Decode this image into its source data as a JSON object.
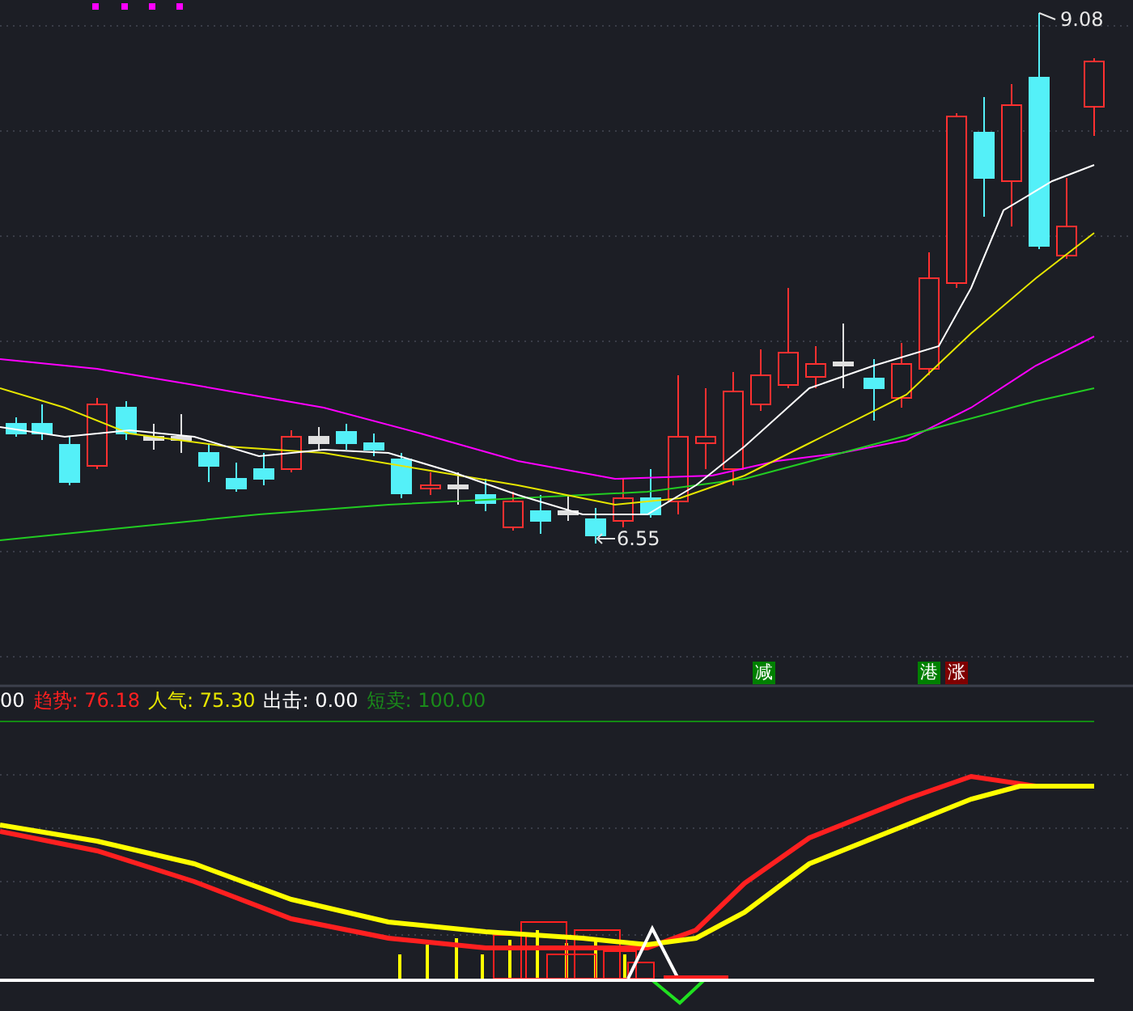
{
  "price_panel": {
    "high_label": "9.08",
    "low_label": "6.55"
  },
  "signals": [
    {
      "text": "减",
      "color": "#008000"
    },
    {
      "text": "港",
      "color": "#008000"
    },
    {
      "text": "涨",
      "color": "#800000"
    }
  ],
  "indicator_legend": [
    {
      "label": "00",
      "color": "#ffffff"
    },
    {
      "label": "趋势: 76.18",
      "color": "#ff2020"
    },
    {
      "label": "人气: 75.30",
      "color": "#e6e600"
    },
    {
      "label": "出击: 0.00",
      "color": "#ffffff"
    },
    {
      "label": "短卖: 100.00",
      "color": "#1a8a1a"
    }
  ]
}
